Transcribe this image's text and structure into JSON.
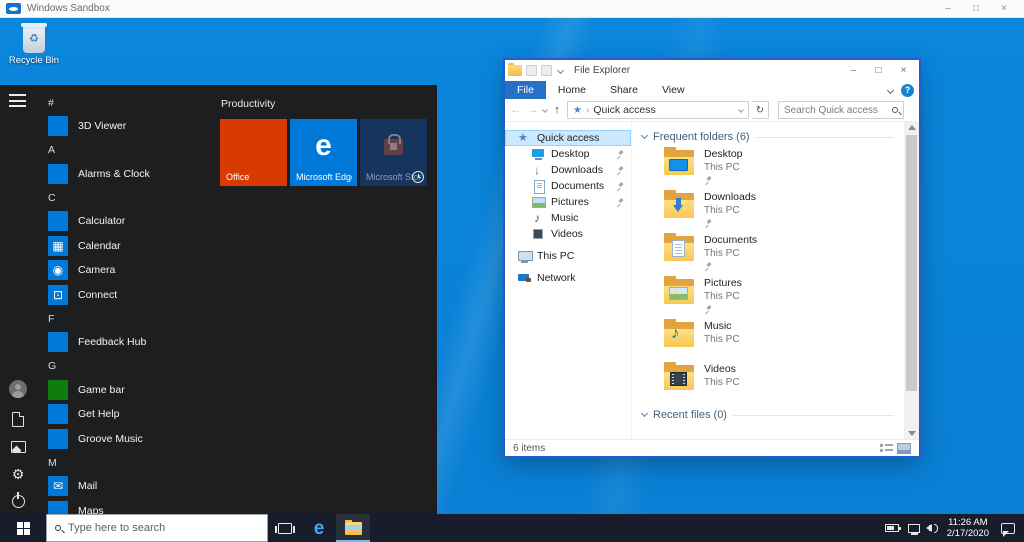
{
  "colors": {
    "accent": "#0078d7",
    "desktop_blue": "#0a86dc",
    "taskbar_dark": "#171d2b",
    "office_orange": "#d83b01",
    "edge_blue": "#0078d7",
    "store_navy": "#15355e",
    "game_green": "#107c10",
    "selection_blue": "#cce8ff",
    "window_border": "#2759cf"
  },
  "sandbox_window": {
    "title": "Windows Sandbox",
    "minimize": "–",
    "maximize": "□",
    "close": "×"
  },
  "desktop": {
    "recycle_bin_label": "Recycle Bin",
    "recycle_glyph": "♻"
  },
  "start_menu": {
    "sections": [
      {
        "letter": "#",
        "apps": [
          {
            "label": "3D Viewer",
            "color": "#0078d7",
            "glyph": "",
            "icon_name": "3d-viewer-icon"
          }
        ]
      },
      {
        "letter": "A",
        "apps": [
          {
            "label": "Alarms & Clock",
            "color": "#0078d7",
            "glyph": "",
            "icon_name": "alarms-clock-icon"
          }
        ]
      },
      {
        "letter": "C",
        "apps": [
          {
            "label": "Calculator",
            "color": "#0078d7",
            "glyph": "",
            "icon_name": "calculator-icon"
          },
          {
            "label": "Calendar",
            "color": "#0078d7",
            "glyph": "▦",
            "icon_name": "calendar-icon"
          },
          {
            "label": "Camera",
            "color": "#0078d7",
            "glyph": "◉",
            "icon_name": "camera-icon"
          },
          {
            "label": "Connect",
            "color": "#0078d7",
            "glyph": "⊡",
            "icon_name": "connect-icon"
          }
        ]
      },
      {
        "letter": "F",
        "apps": [
          {
            "label": "Feedback Hub",
            "color": "#0078d7",
            "glyph": "",
            "icon_name": "feedback-hub-icon"
          }
        ]
      },
      {
        "letter": "G",
        "apps": [
          {
            "label": "Game bar",
            "color": "#107c10",
            "glyph": "",
            "icon_name": "game-bar-icon"
          },
          {
            "label": "Get Help",
            "color": "#0078d7",
            "glyph": "",
            "icon_name": "get-help-icon"
          },
          {
            "label": "Groove Music",
            "color": "#0078d7",
            "glyph": "",
            "icon_name": "groove-music-icon"
          }
        ]
      },
      {
        "letter": "M",
        "apps": [
          {
            "label": "Mail",
            "color": "#0078d7",
            "glyph": "✉",
            "icon_name": "mail-icon"
          },
          {
            "label": "Maps",
            "color": "#0078d7",
            "glyph": "",
            "icon_name": "maps-icon"
          }
        ]
      }
    ],
    "tile_group_title": "Productivity",
    "tiles": [
      {
        "label": "Office",
        "color": "#d83b01",
        "glyph": "",
        "icon_name": "office-tile"
      },
      {
        "label": "Microsoft Edge",
        "color": "#0078d7",
        "glyph": "e",
        "icon_name": "edge-tile"
      },
      {
        "label": "Microsoft Store",
        "color": "#15355e",
        "glyph": "",
        "icon_name": "store-tile",
        "pending": true,
        "has_bag": true
      }
    ]
  },
  "explorer": {
    "title": "File Explorer",
    "controls": {
      "minimize": "–",
      "maximize": "□",
      "close": "×"
    },
    "tabs": [
      {
        "label": "File",
        "active": "true"
      },
      {
        "label": "Home"
      },
      {
        "label": "Share"
      },
      {
        "label": "View"
      }
    ],
    "help_glyph": "?",
    "nav": {
      "back": "←",
      "forward": "→",
      "up": "↑",
      "refresh": "↻",
      "crumb_sep": "›"
    },
    "address": "Quick access",
    "search_placeholder": "Search Quick access",
    "sidebar": {
      "quick_access": "Quick access",
      "items": [
        {
          "name": "Desktop",
          "icon": "desktop",
          "icon_name": "desktop-icon",
          "pinned": true
        },
        {
          "name": "Downloads",
          "icon": "downloads",
          "icon_name": "downloads-icon",
          "pinned": true
        },
        {
          "name": "Documents",
          "icon": "documents",
          "icon_name": "documents-icon",
          "pinned": true
        },
        {
          "name": "Pictures",
          "icon": "pictures",
          "icon_name": "pictures-icon",
          "pinned": true
        },
        {
          "name": "Music",
          "icon": "music",
          "icon_name": "music-icon"
        },
        {
          "name": "Videos",
          "icon": "videos",
          "icon_name": "videos-icon"
        }
      ],
      "this_pc": "This PC",
      "network": "Network"
    },
    "main": {
      "frequent_header": "Frequent folders (6)",
      "folders": [
        {
          "name": "Desktop",
          "location": "This PC",
          "icon": "desktop",
          "icon_name": "desktop-folder-icon",
          "pinned": true
        },
        {
          "name": "Downloads",
          "location": "This PC",
          "icon": "downloads",
          "icon_name": "downloads-folder-icon",
          "pinned": true
        },
        {
          "name": "Documents",
          "location": "This PC",
          "icon": "documents",
          "icon_name": "documents-folder-icon",
          "pinned": true
        },
        {
          "name": "Pictures",
          "location": "This PC",
          "icon": "pictures",
          "icon_name": "pictures-folder-icon",
          "pinned": true
        },
        {
          "name": "Music",
          "location": "This PC",
          "icon": "music",
          "icon_name": "music-folder-icon"
        },
        {
          "name": "Videos",
          "location": "This PC",
          "icon": "videos",
          "icon_name": "videos-folder-icon"
        }
      ],
      "recent_header": "Recent files (0)"
    },
    "status": "6 items"
  },
  "taskbar": {
    "search_placeholder": "Type here to search",
    "tray": {
      "time": "11:26 AM",
      "date": "2/17/2020"
    }
  }
}
